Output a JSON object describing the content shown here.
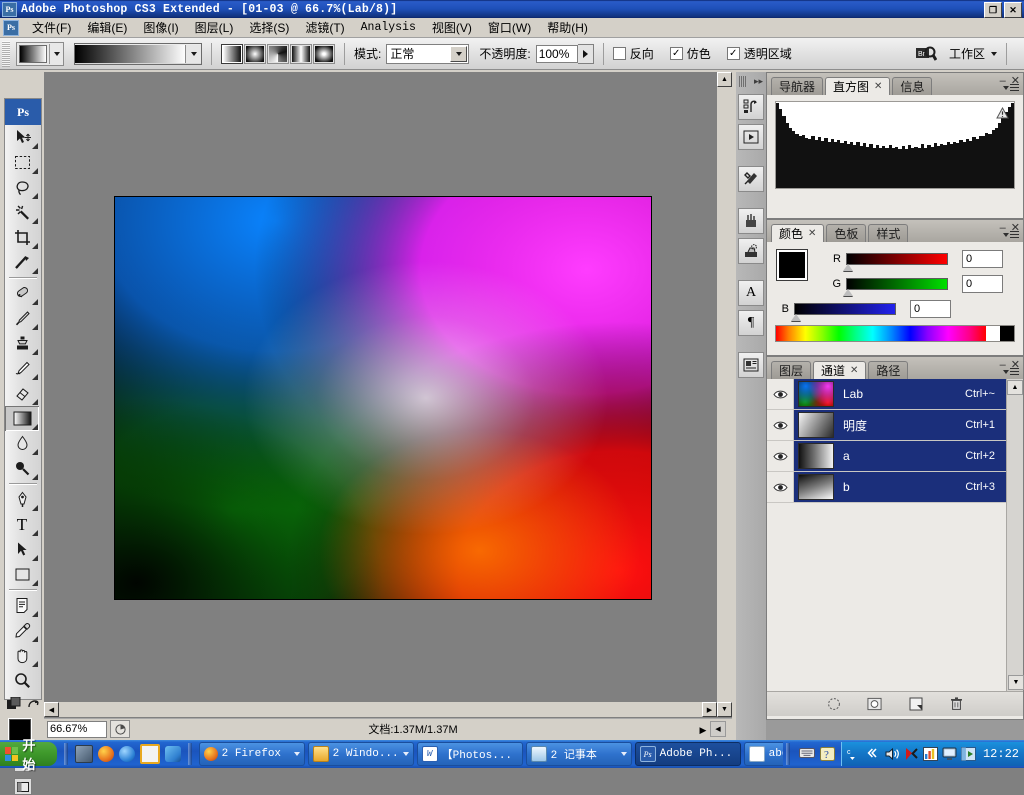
{
  "window": {
    "title": "Adobe Photoshop CS3 Extended - [01-03 @ 66.7%(Lab/8)]",
    "app_icon": "photoshop-icon",
    "restore_label": "❐",
    "close_label": "✕"
  },
  "menubar": {
    "items": [
      {
        "label": "文件(F)",
        "name": "menu-file"
      },
      {
        "label": "编辑(E)",
        "name": "menu-edit"
      },
      {
        "label": "图像(I)",
        "name": "menu-image"
      },
      {
        "label": "图层(L)",
        "name": "menu-layer"
      },
      {
        "label": "选择(S)",
        "name": "menu-select"
      },
      {
        "label": "滤镜(T)",
        "name": "menu-filter"
      },
      {
        "label": "Analysis",
        "name": "menu-analysis"
      },
      {
        "label": "视图(V)",
        "name": "menu-view"
      },
      {
        "label": "窗口(W)",
        "name": "menu-window"
      },
      {
        "label": "帮助(H)",
        "name": "menu-help"
      }
    ]
  },
  "options_bar": {
    "gradient_preset_name": "gradient-preset-picker",
    "gradient_types": [
      "linear-gradient",
      "radial-gradient",
      "angle-gradient",
      "reflected-gradient",
      "diamond-gradient"
    ],
    "mode_label": "模式:",
    "mode_value": "正常",
    "opacity_label": "不透明度:",
    "opacity_value": "100%",
    "checkboxes": [
      {
        "label": "反向",
        "checked": false
      },
      {
        "label": "仿色",
        "checked": true
      },
      {
        "label": "透明区域",
        "checked": true
      }
    ],
    "workspace_label": "工作区",
    "bridge_icon": "go-to-bridge-icon"
  },
  "toolbox": {
    "logo": "Ps",
    "tools": [
      {
        "name": "move-tool",
        "glyph": "↖"
      },
      {
        "name": "marquee-tool",
        "glyph": "⬚"
      },
      {
        "name": "lasso-tool",
        "glyph": "☄"
      },
      {
        "name": "magic-wand-tool",
        "glyph": "✳"
      },
      {
        "name": "crop-tool",
        "glyph": "⌗"
      },
      {
        "name": "slice-tool",
        "glyph": "✂"
      },
      {
        "name": "healing-brush-tool",
        "glyph": "✐"
      },
      {
        "name": "brush-tool",
        "glyph": "✎"
      },
      {
        "name": "clone-stamp-tool",
        "glyph": "⎙"
      },
      {
        "name": "history-brush-tool",
        "glyph": "✒"
      },
      {
        "name": "eraser-tool",
        "glyph": "▱"
      },
      {
        "name": "gradient-tool",
        "glyph": "■",
        "selected": true
      },
      {
        "name": "blur-tool",
        "glyph": "●"
      },
      {
        "name": "dodge-tool",
        "glyph": "◖"
      },
      {
        "name": "pen-tool",
        "glyph": "✒"
      },
      {
        "name": "type-tool",
        "glyph": "T"
      },
      {
        "name": "path-selection-tool",
        "glyph": "➤"
      },
      {
        "name": "shape-tool",
        "glyph": "▭"
      },
      {
        "name": "notes-tool",
        "glyph": "☰"
      },
      {
        "name": "eyedropper-tool",
        "glyph": "╱"
      },
      {
        "name": "hand-tool",
        "glyph": "✋"
      },
      {
        "name": "zoom-tool",
        "glyph": "⚲"
      }
    ],
    "foreground_color": "#000000",
    "background_color": "#ffffff",
    "quick_mask_label": "quick-mask-mode",
    "screen_mode_label": "screen-mode"
  },
  "document": {
    "zoom_value": "66.67%",
    "doc_size_label": "文档:1.37M/1.37M",
    "image_name": "lab-gradient-composite"
  },
  "dock_strip": {
    "icons": [
      {
        "name": "history-panel-icon"
      },
      {
        "name": "actions-panel-icon"
      },
      {
        "name": "tool-presets-panel-icon"
      },
      {
        "name": "brushes-panel-icon"
      },
      {
        "name": "clone-source-panel-icon"
      },
      {
        "name": "character-panel-icon"
      },
      {
        "name": "paragraph-panel-icon"
      },
      {
        "name": "layer-comps-panel-icon"
      }
    ],
    "collapse_label": "▸▸"
  },
  "histogram_panel": {
    "tabs": [
      {
        "label": "导航器",
        "active": false
      },
      {
        "label": "直方图",
        "active": true
      },
      {
        "label": "信息",
        "active": false
      }
    ],
    "warning_icon": "cached-data-warning-icon"
  },
  "color_panel": {
    "tabs": [
      {
        "label": "颜色",
        "active": true
      },
      {
        "label": "色板",
        "active": false
      },
      {
        "label": "样式",
        "active": false
      }
    ],
    "foreground_color": "#000000",
    "background_color": "#ffffff",
    "sliders": [
      {
        "channel": "R",
        "value": "0",
        "track_color": "#ff0000"
      },
      {
        "channel": "G",
        "value": "0",
        "track_color": "#00ff00"
      },
      {
        "channel": "B",
        "value": "0",
        "track_color": "#0000ff"
      }
    ]
  },
  "channels_panel": {
    "tabs": [
      {
        "label": "图层",
        "active": false
      },
      {
        "label": "通道",
        "active": true
      },
      {
        "label": "路径",
        "active": false
      }
    ],
    "rows": [
      {
        "name": "Lab",
        "shortcut": "Ctrl+~",
        "visible": true,
        "selected": true,
        "thumb": "composite"
      },
      {
        "name": "明度",
        "shortcut": "Ctrl+1",
        "visible": true,
        "selected": true,
        "thumb": "lightness"
      },
      {
        "name": "a",
        "shortcut": "Ctrl+2",
        "visible": true,
        "selected": true,
        "thumb": "a-channel"
      },
      {
        "name": "b",
        "shortcut": "Ctrl+3",
        "visible": true,
        "selected": true,
        "thumb": "b-channel"
      }
    ],
    "footer_icons": [
      {
        "name": "load-channel-as-selection-icon"
      },
      {
        "name": "save-selection-as-channel-icon"
      },
      {
        "name": "new-channel-icon"
      },
      {
        "name": "delete-channel-icon"
      }
    ]
  },
  "taskbar": {
    "start_label": "开始",
    "quick_launch": [
      {
        "name": "show-desktop-icon",
        "color": "#6b7b8c"
      },
      {
        "name": "firefox-icon",
        "color": "#e8741e"
      },
      {
        "name": "internet-explorer-icon",
        "color": "#2a7fd4"
      },
      {
        "name": "clock-icon",
        "color": "#e8a820"
      },
      {
        "name": "media-icon",
        "color": "#2f7fd0"
      }
    ],
    "tasks": [
      {
        "label": "2 Firefox",
        "icon_color": "#e8741e",
        "group": true
      },
      {
        "label": "2 Windo...",
        "icon_color": "#f0c040",
        "group": true
      },
      {
        "label": "【Photos...",
        "icon_color": "#2a5fb0",
        "group": false
      },
      {
        "label": "2 记事本",
        "icon_color": "#cfe4f7",
        "group": true
      },
      {
        "label": "Adobe Ph...",
        "icon_color": "#2a5caa",
        "group": false
      },
      {
        "label": "about:bl...",
        "icon_color": "#2a7fd4",
        "group": false
      }
    ],
    "tray_icons": [
      {
        "name": "keyboard-icon"
      },
      {
        "name": "help-icon"
      },
      {
        "name": "language-bar-icon"
      },
      {
        "name": "show-hidden-icons-icon"
      },
      {
        "name": "volume-icon"
      },
      {
        "name": "kaspersky-icon"
      },
      {
        "name": "network-monitor-icon"
      },
      {
        "name": "display-icon"
      },
      {
        "name": "media-player-icon"
      }
    ],
    "clock": "12:22"
  }
}
